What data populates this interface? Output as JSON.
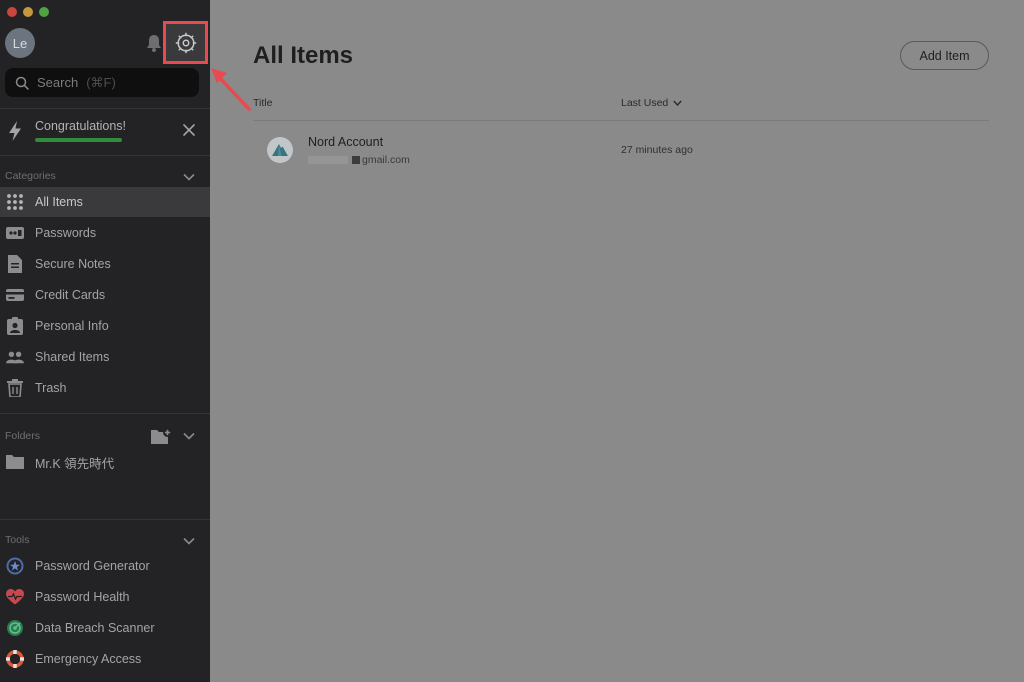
{
  "window": {
    "traffic_lights": [
      "close",
      "minimize",
      "zoom"
    ]
  },
  "colors": {
    "sidebar_bg": "#232325",
    "main_bg": "#8a8a8a",
    "accent_highlight": "#e84a4f",
    "progress_green": "#2e8c3b"
  },
  "profile": {
    "avatar_initials": "Le"
  },
  "search": {
    "placeholder": "Search",
    "shortcut": "(⌘F)"
  },
  "notification": {
    "message": "Congratulations!",
    "progress": 1.0
  },
  "sidebar": {
    "categories_label": "Categories",
    "categories": [
      {
        "label": "All Items",
        "icon": "grid-icon",
        "active": true
      },
      {
        "label": "Passwords",
        "icon": "password-icon"
      },
      {
        "label": "Secure Notes",
        "icon": "note-icon"
      },
      {
        "label": "Credit Cards",
        "icon": "credit-card-icon"
      },
      {
        "label": "Personal Info",
        "icon": "id-card-icon"
      },
      {
        "label": "Shared Items",
        "icon": "people-icon"
      },
      {
        "label": "Trash",
        "icon": "trash-icon"
      }
    ],
    "folders_label": "Folders",
    "folders": [
      {
        "label": "Mr.K 領先時代",
        "icon": "folder-icon"
      }
    ],
    "tools_label": "Tools",
    "tools": [
      {
        "label": "Password Generator",
        "icon": "generator-icon"
      },
      {
        "label": "Password Health",
        "icon": "heart-icon"
      },
      {
        "label": "Data Breach Scanner",
        "icon": "scanner-icon"
      },
      {
        "label": "Emergency Access",
        "icon": "lifebuoy-icon"
      }
    ]
  },
  "main": {
    "title": "All Items",
    "add_item_label": "Add Item",
    "columns": {
      "title": "Title",
      "last_used": "Last Used"
    },
    "items": [
      {
        "name": "Nord Account",
        "subtitle": "gmail.com",
        "last_used": "27 minutes ago"
      }
    ]
  }
}
